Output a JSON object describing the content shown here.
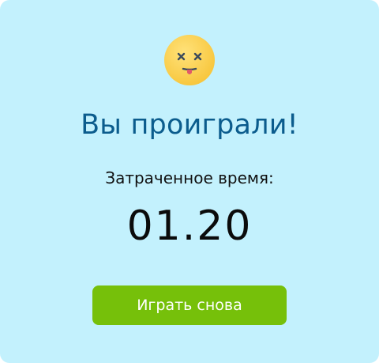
{
  "result": {
    "emoji_icon": "dizzy-face-icon",
    "title": "Вы проиграли!",
    "time_label": "Затраченное время:",
    "time_value": "01.20",
    "retry_label": "Играть снова"
  },
  "colors": {
    "background": "#c3f1fd",
    "title": "#0b5c8d",
    "button": "#76c00a",
    "emoji_face": "#ffd75a"
  }
}
